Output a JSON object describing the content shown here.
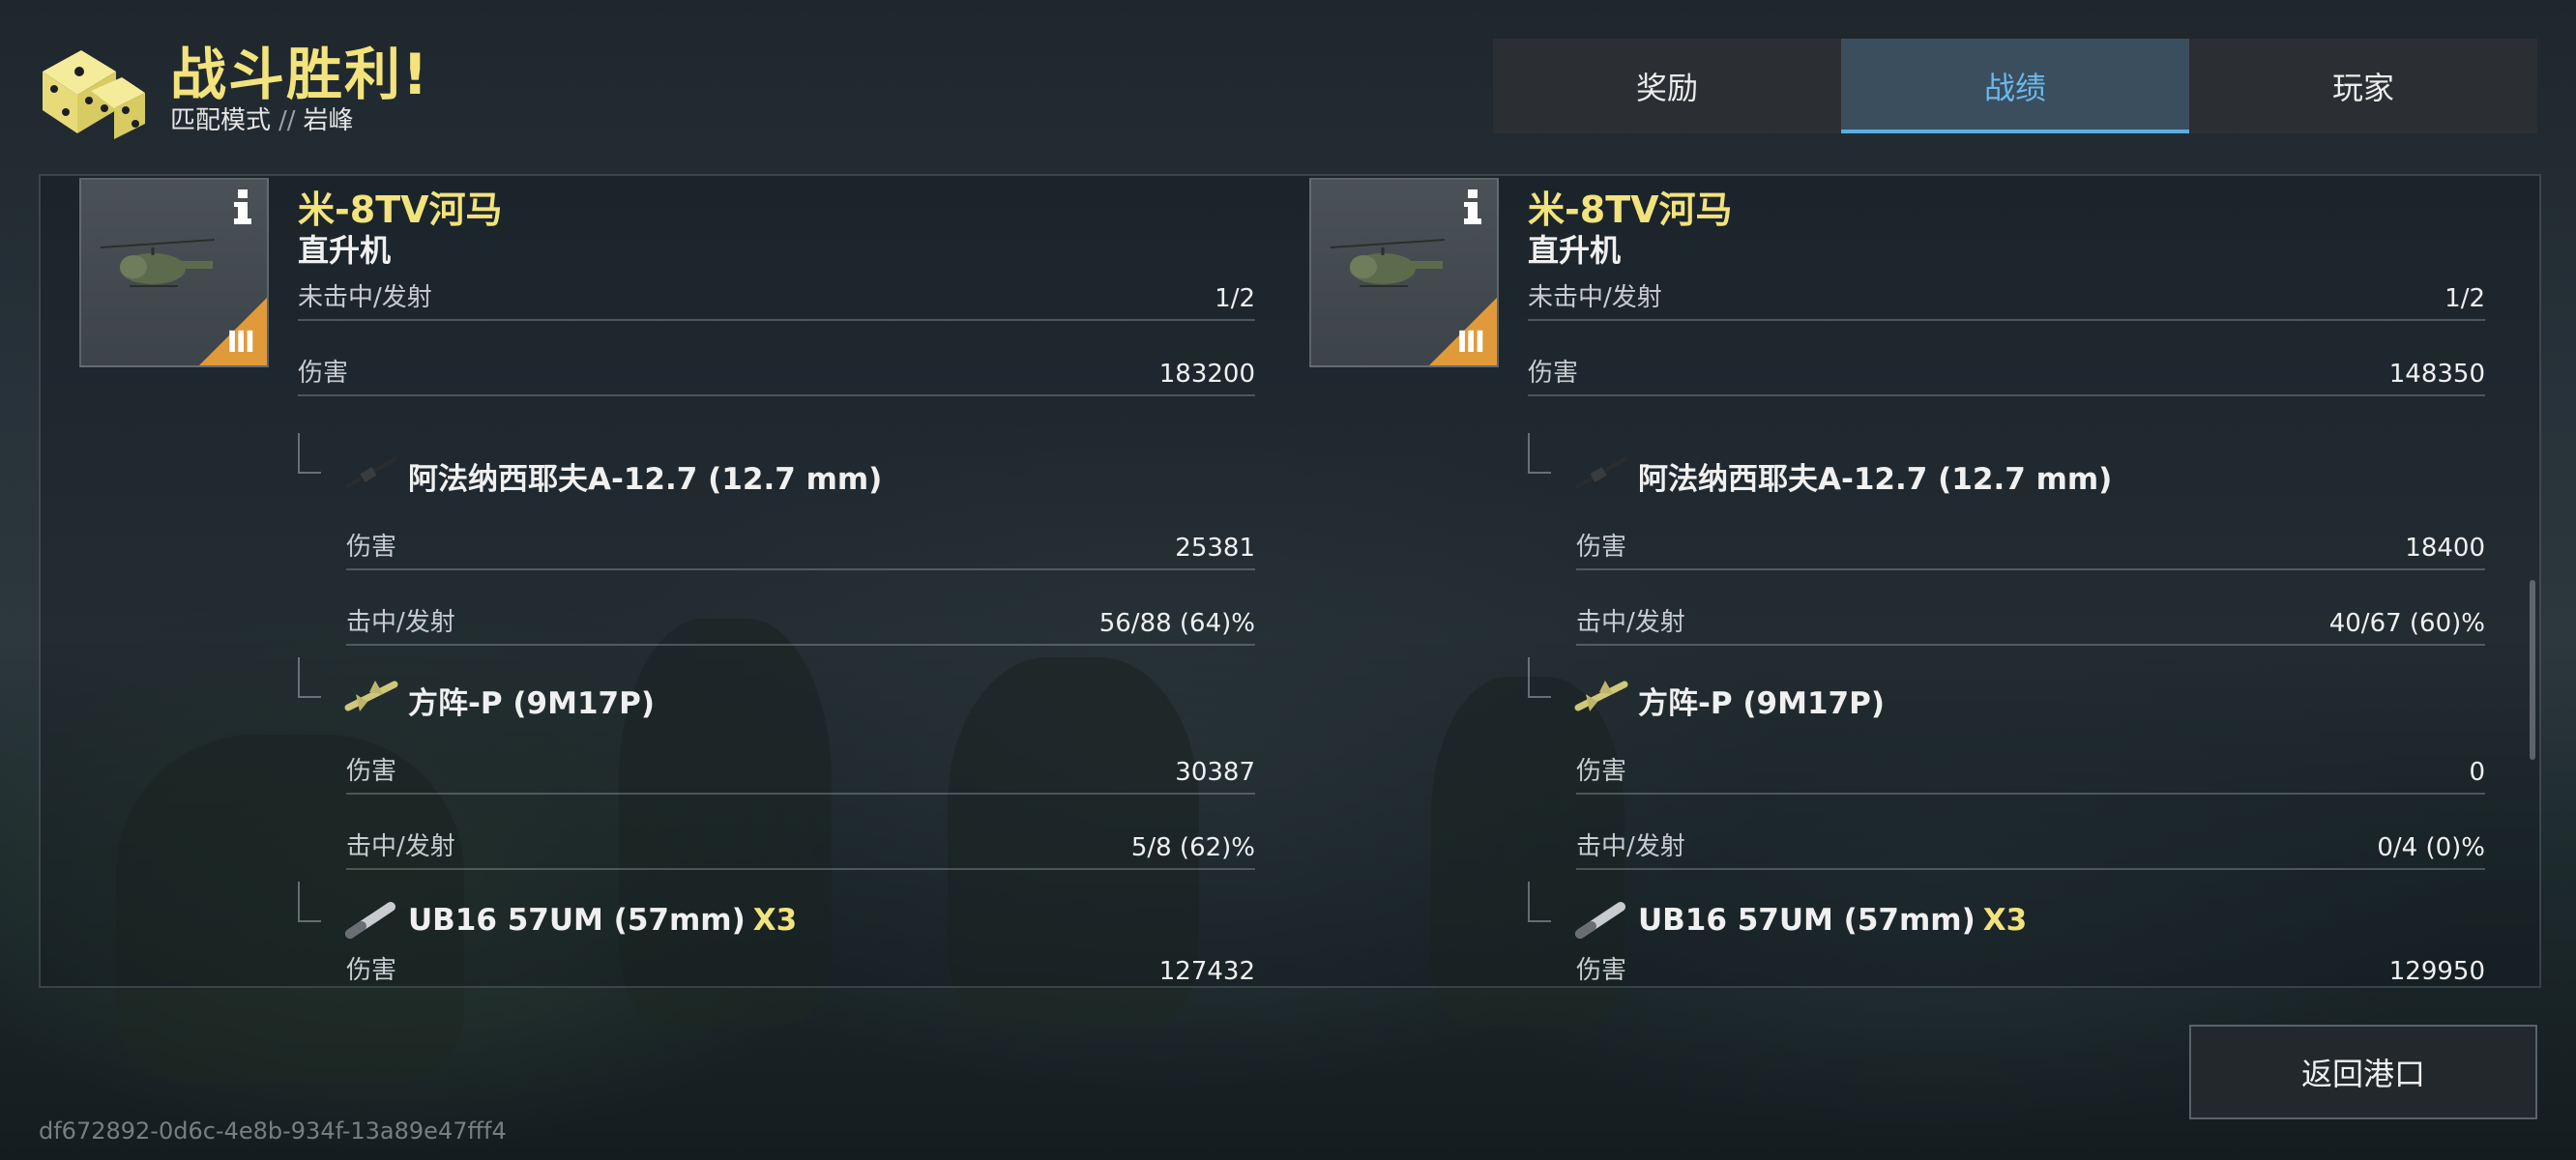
{
  "header": {
    "title": "战斗胜利!",
    "mode": "匹配模式",
    "separator": "//",
    "map": "岩峰"
  },
  "tabs": [
    {
      "label": "奖励",
      "active": false
    },
    {
      "label": "战绩",
      "active": true
    },
    {
      "label": "玩家",
      "active": false
    }
  ],
  "vehicles": [
    {
      "name": "米-8TV河马",
      "class": "直升机",
      "rank": "III",
      "stats": [
        {
          "label": "未击中/发射",
          "value": "1/2"
        },
        {
          "label": "伤害",
          "value": "183200"
        }
      ],
      "weapons": [
        {
          "name": "阿法纳西耶夫A-12.7 (12.7 mm)",
          "multiplier": "",
          "icon": "machine-gun-icon",
          "stats": [
            {
              "label": "伤害",
              "value": "25381"
            },
            {
              "label": "击中/发射",
              "value": "56/88 (64)%"
            }
          ]
        },
        {
          "name": "方阵-P (9M17P)",
          "multiplier": "",
          "icon": "missile-icon",
          "stats": [
            {
              "label": "伤害",
              "value": "30387"
            },
            {
              "label": "击中/发射",
              "value": "5/8 (62)%"
            }
          ]
        },
        {
          "name": "UB16 57UM (57mm)",
          "multiplier": "X3",
          "icon": "rocket-pod-icon",
          "stats": [
            {
              "label": "伤害",
              "value": "127432"
            }
          ]
        }
      ]
    },
    {
      "name": "米-8TV河马",
      "class": "直升机",
      "rank": "III",
      "stats": [
        {
          "label": "未击中/发射",
          "value": "1/2"
        },
        {
          "label": "伤害",
          "value": "148350"
        }
      ],
      "weapons": [
        {
          "name": "阿法纳西耶夫A-12.7 (12.7 mm)",
          "multiplier": "",
          "icon": "machine-gun-icon",
          "stats": [
            {
              "label": "伤害",
              "value": "18400"
            },
            {
              "label": "击中/发射",
              "value": "40/67 (60)%"
            }
          ]
        },
        {
          "name": "方阵-P (9M17P)",
          "multiplier": "",
          "icon": "missile-icon",
          "stats": [
            {
              "label": "伤害",
              "value": "0"
            },
            {
              "label": "击中/发射",
              "value": "0/4 (0)%"
            }
          ]
        },
        {
          "name": "UB16 57UM (57mm)",
          "multiplier": "X3",
          "icon": "rocket-pod-icon",
          "stats": [
            {
              "label": "伤害",
              "value": "129950"
            }
          ]
        }
      ]
    }
  ],
  "return_button": "返回港口",
  "battle_id": "df672892-0d6c-4e8b-934f-13a89e47fff4",
  "colors": {
    "title_yellow": "#f2e37c",
    "tab_active_bg": "#3b4e5e",
    "tab_active_text": "#6ab8ea",
    "rank_orange": "#e09a3a"
  }
}
